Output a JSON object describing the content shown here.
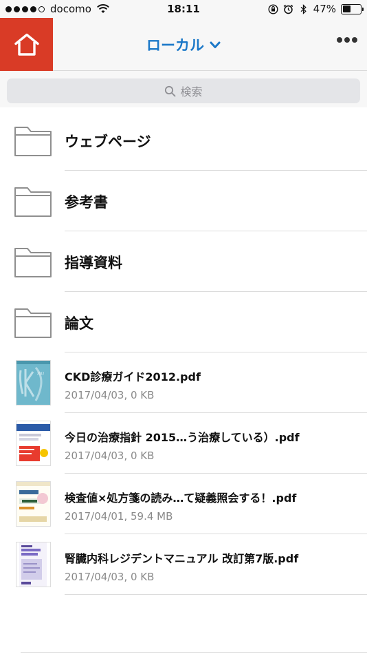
{
  "status_bar": {
    "carrier": "docomo",
    "time": "18:11",
    "battery_percent_text": "47%",
    "battery_level": 0.47,
    "signal_bars_filled": 4,
    "signal_bars_total": 5
  },
  "nav": {
    "title": "ローカル",
    "home_icon": "home-icon",
    "more_icon": "more-icon",
    "accent_color": "#1b78c8",
    "home_bg_color": "#d93b26"
  },
  "search": {
    "placeholder": "検索"
  },
  "folders": [
    {
      "name": "ウェブページ"
    },
    {
      "name": "参考書"
    },
    {
      "name": "指導資料"
    },
    {
      "name": "論文"
    }
  ],
  "files": [
    {
      "name": "CKD診療ガイド2012.pdf",
      "meta": "2017/04/03, 0 KB",
      "thumb_text": "CKD"
    },
    {
      "name": "今日の治療指針 2015…う治療している）.pdf",
      "meta": "2017/04/03, 0 KB",
      "thumb_text": "今日の治療指針"
    },
    {
      "name": "検査値×処方箋の読み…て疑義照会する！.pdf",
      "meta": "2017/04/01, 59.4 MB",
      "thumb_text": "検査値"
    },
    {
      "name": "腎臓内科レジデントマニュアル 改訂第7版.pdf",
      "meta": "2017/04/03, 0 KB",
      "thumb_text": "腎臓内科"
    }
  ]
}
